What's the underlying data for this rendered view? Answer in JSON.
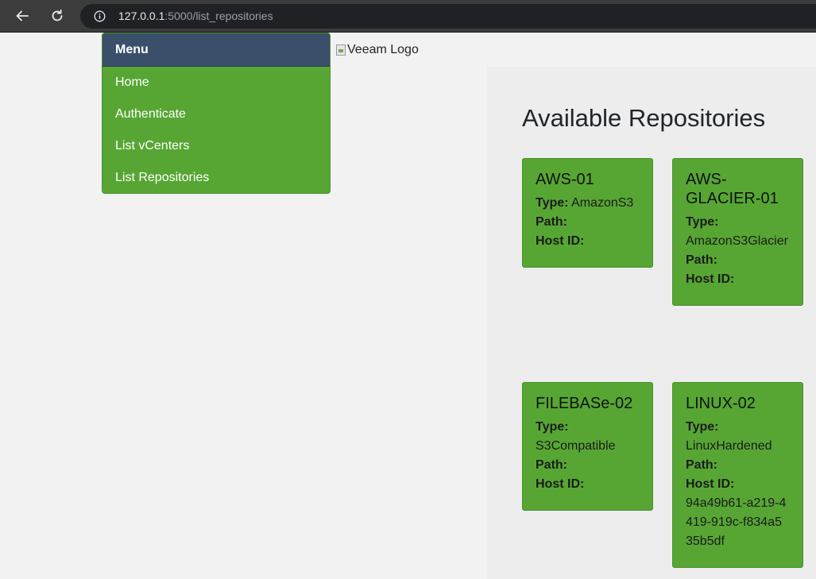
{
  "browser": {
    "url_host": "127.0.0.1",
    "url_path": ":5000/list_repositories"
  },
  "menu": {
    "header": "Menu",
    "items": [
      {
        "label": "Home"
      },
      {
        "label": "Authenticate"
      },
      {
        "label": "List vCenters"
      },
      {
        "label": "List Repositories"
      }
    ]
  },
  "logo": {
    "alt": "Veeam Logo"
  },
  "page": {
    "title": "Available Repositories"
  },
  "labels": {
    "type": "Type:",
    "path": "Path:",
    "host_id": "Host ID:"
  },
  "repositories": [
    {
      "name": "AWS-01",
      "type": "AmazonS3",
      "path": "",
      "host_id": ""
    },
    {
      "name": "AWS-\nGLACIER-01",
      "type": "AmazonS3Glacier",
      "path": "",
      "host_id": ""
    },
    {
      "name": "FILEBASe-02",
      "type": "S3Compatible",
      "path": "",
      "host_id": ""
    },
    {
      "name": "LINUX-02",
      "type": "LinuxHardened",
      "path": "",
      "host_id": "94a49b61-a219-4419-919c-f834a535b5df"
    }
  ]
}
